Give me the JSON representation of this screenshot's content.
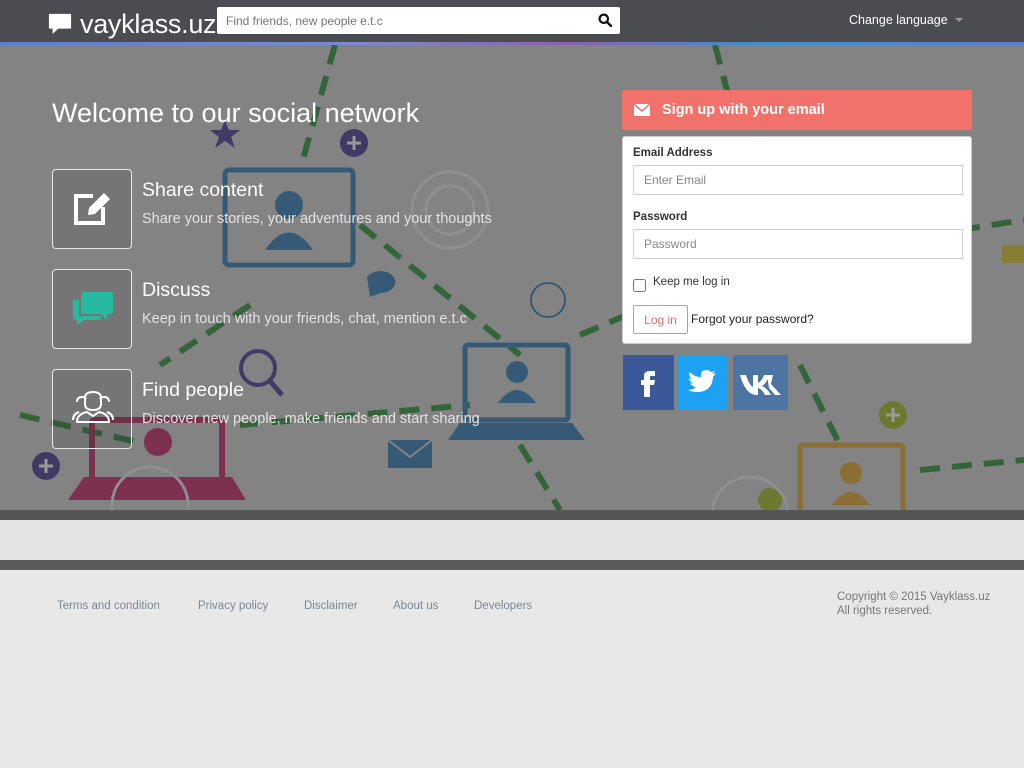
{
  "header": {
    "logo_text": "vayklass.uz",
    "search_placeholder": "Find friends, new people e.t.c",
    "change_language_label": "Change language"
  },
  "hero": {
    "welcome_title": "Welcome to our social network",
    "features": [
      {
        "title": "Share content",
        "description": "Share your stories, your adventures and your thoughts",
        "icon": "edit-icon"
      },
      {
        "title": "Discuss",
        "description": "Keep in touch with your friends, chat, mention e.t.c",
        "icon": "chat-icon"
      },
      {
        "title": "Find people",
        "description": "Discover new people, make friends and start sharing",
        "icon": "people-icon"
      }
    ]
  },
  "signup": {
    "header_label": "Sign up with your email",
    "email_label": "Email Address",
    "email_placeholder": "Enter Email",
    "password_label": "Password",
    "password_placeholder": "Password",
    "keep_logged_label": "Keep me log in",
    "login_button": "Log in",
    "forgot_link": "Forgot your password?",
    "social": [
      {
        "icon": "facebook-icon",
        "color": "#3b5998"
      },
      {
        "icon": "twitter-icon",
        "color": "#1da1f2"
      },
      {
        "icon": "vk-icon",
        "color": "#4c75a3"
      }
    ]
  },
  "footer": {
    "links": [
      "Terms and condition",
      "Privacy policy",
      "Disclaimer",
      "About us",
      "Developers"
    ],
    "copyright_line1": "Copyright © 2015 Vayklass.uz",
    "copyright_line2": "All rights reserved."
  },
  "colors": {
    "header_bg": "#4a4c52",
    "accent": "#f0726a",
    "footer_link": "#7b8794"
  }
}
